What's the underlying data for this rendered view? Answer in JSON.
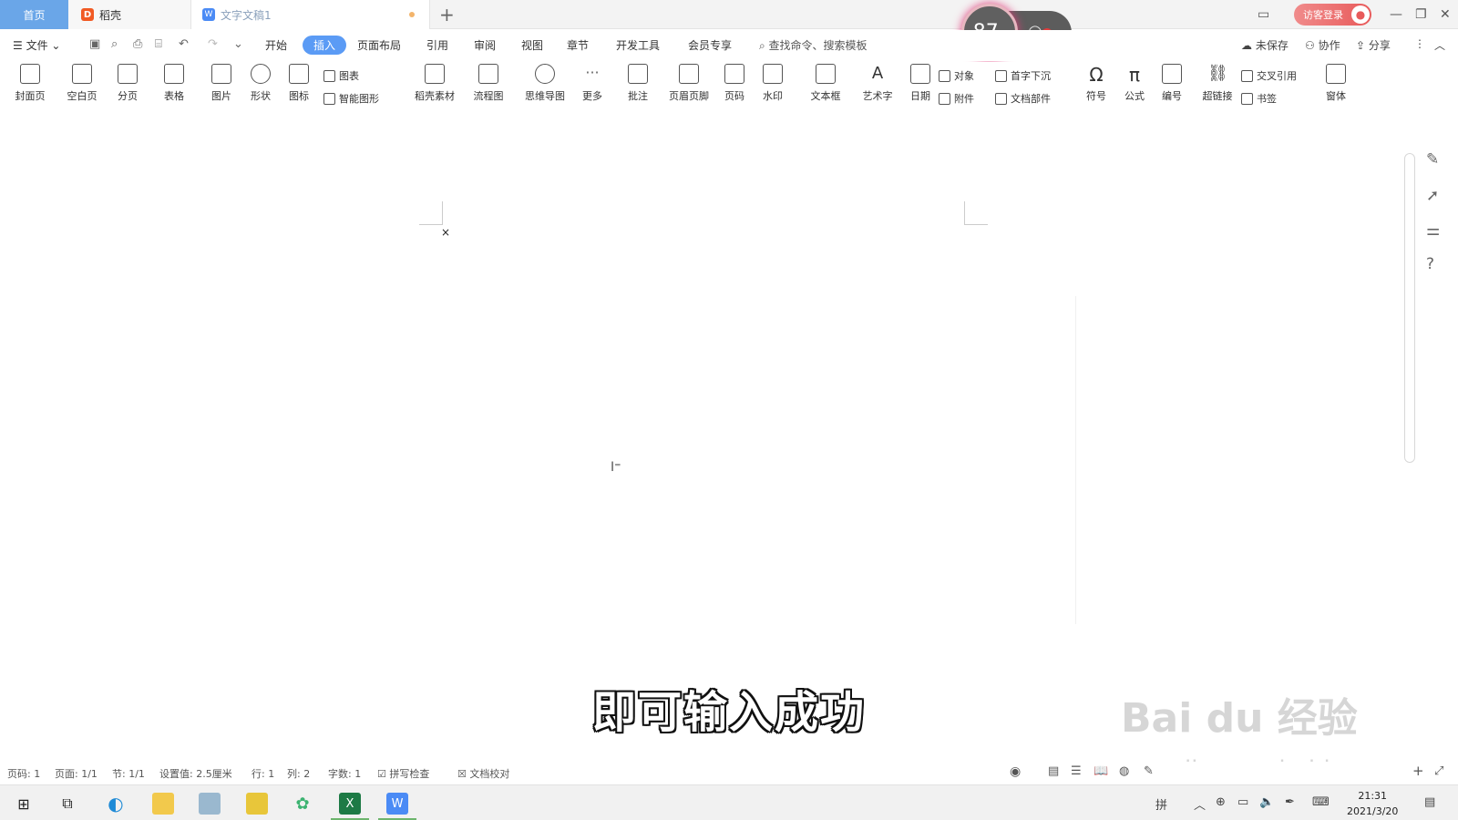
{
  "tabs": {
    "home": "首页",
    "daoke": "稻壳",
    "doc": "文字文稿1",
    "login": "访客登录"
  },
  "network": {
    "percent": "87",
    "unit": "%"
  },
  "menu": {
    "file": "文件",
    "items": [
      "开始",
      "插入",
      "页面布局",
      "引用",
      "审阅",
      "视图",
      "章节",
      "开发工具",
      "会员专享"
    ],
    "search": "查找命令、搜索模板",
    "unsaved": "未保存",
    "collab": "协作",
    "share": "分享"
  },
  "ribbon": {
    "cover": "封面页",
    "blank": "空白页",
    "break": "分页",
    "table": "表格",
    "picture": "图片",
    "shape": "形状",
    "icons": "图标",
    "chart": "图表",
    "smartart": "智能图形",
    "daoke_material": "稻壳素材",
    "flowchart": "流程图",
    "mindmap": "思维导图",
    "more": "更多",
    "comment": "批注",
    "header_footer": "页眉页脚",
    "page_number": "页码",
    "watermark": "水印",
    "textbox": "文本框",
    "wordart": "艺术字",
    "date": "日期",
    "object": "对象",
    "attachment": "附件",
    "dropcap": "首字下沉",
    "doc_parts": "文档部件",
    "symbol": "符号",
    "formula": "公式",
    "numbering": "编号",
    "hyperlink": "超链接",
    "crossref": "交叉引用",
    "bookmark": "书签",
    "window": "窗体"
  },
  "document": {
    "mark": "×",
    "subtitle": "即可输入成功"
  },
  "watermark": {
    "brand": "Bai du 经验",
    "url": "jingyan.baidu.com"
  },
  "status": {
    "page": "页码: 1",
    "pages": "页面: 1/1",
    "section": "节: 1/1",
    "setting": "设置值: 2.5厘米",
    "row": "行: 1",
    "col": "列: 2",
    "words": "字数: 1",
    "spell": "拼写检查",
    "proof": "文档校对"
  },
  "taskbar": {
    "ime": "拼",
    "time": "21:31",
    "date": "2021/3/20"
  }
}
